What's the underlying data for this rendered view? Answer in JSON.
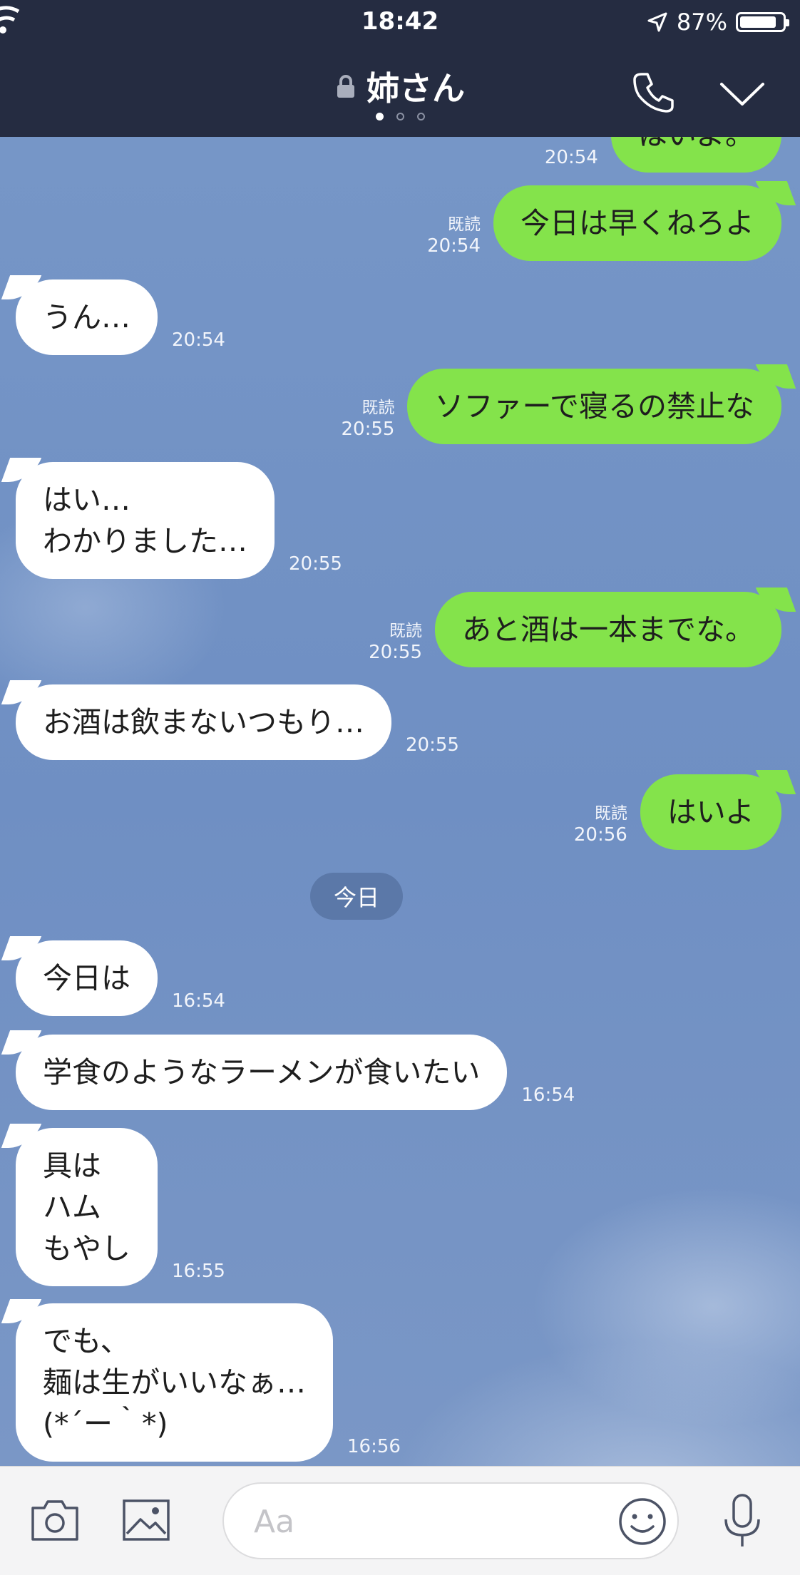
{
  "status": {
    "time": "18:42",
    "battery": "87%",
    "battery_level": 0.87
  },
  "header": {
    "lock_icon": "lock-icon",
    "title": "姉さん",
    "call_icon": "phone-icon",
    "menu_icon": "chevron-down-icon"
  },
  "messages": [
    {
      "side": "out",
      "text": "はいよ。",
      "read": "",
      "time": "20:54"
    },
    {
      "side": "out",
      "text": "今日は早くねろよ",
      "read": "既読",
      "time": "20:54"
    },
    {
      "side": "in",
      "text": "うん…",
      "time": "20:54"
    },
    {
      "side": "out",
      "text": "ソファーで寝るの禁止な",
      "read": "既読",
      "time": "20:55"
    },
    {
      "side": "in",
      "text": "はい…\nわかりました…",
      "time": "20:55"
    },
    {
      "side": "out",
      "text": "あと酒は一本までな。",
      "read": "既読",
      "time": "20:55"
    },
    {
      "side": "in",
      "text": "お酒は飲まないつもり…",
      "time": "20:55"
    },
    {
      "side": "out",
      "text": "はいよ",
      "read": "既読",
      "time": "20:56"
    },
    {
      "side": "in",
      "text": "今日は",
      "time": "16:54"
    },
    {
      "side": "in",
      "text": "学食のようなラーメンが食いたい",
      "time": "16:54"
    },
    {
      "side": "in",
      "text": "具は\nハム\nもやし",
      "time": "16:55"
    },
    {
      "side": "in",
      "text": "でも、\n麺は生がいいなぁ…\n(*´ー｀*)",
      "time": "16:56"
    }
  ],
  "date_chip": "今日",
  "input": {
    "placeholder": "Aa",
    "value": ""
  }
}
